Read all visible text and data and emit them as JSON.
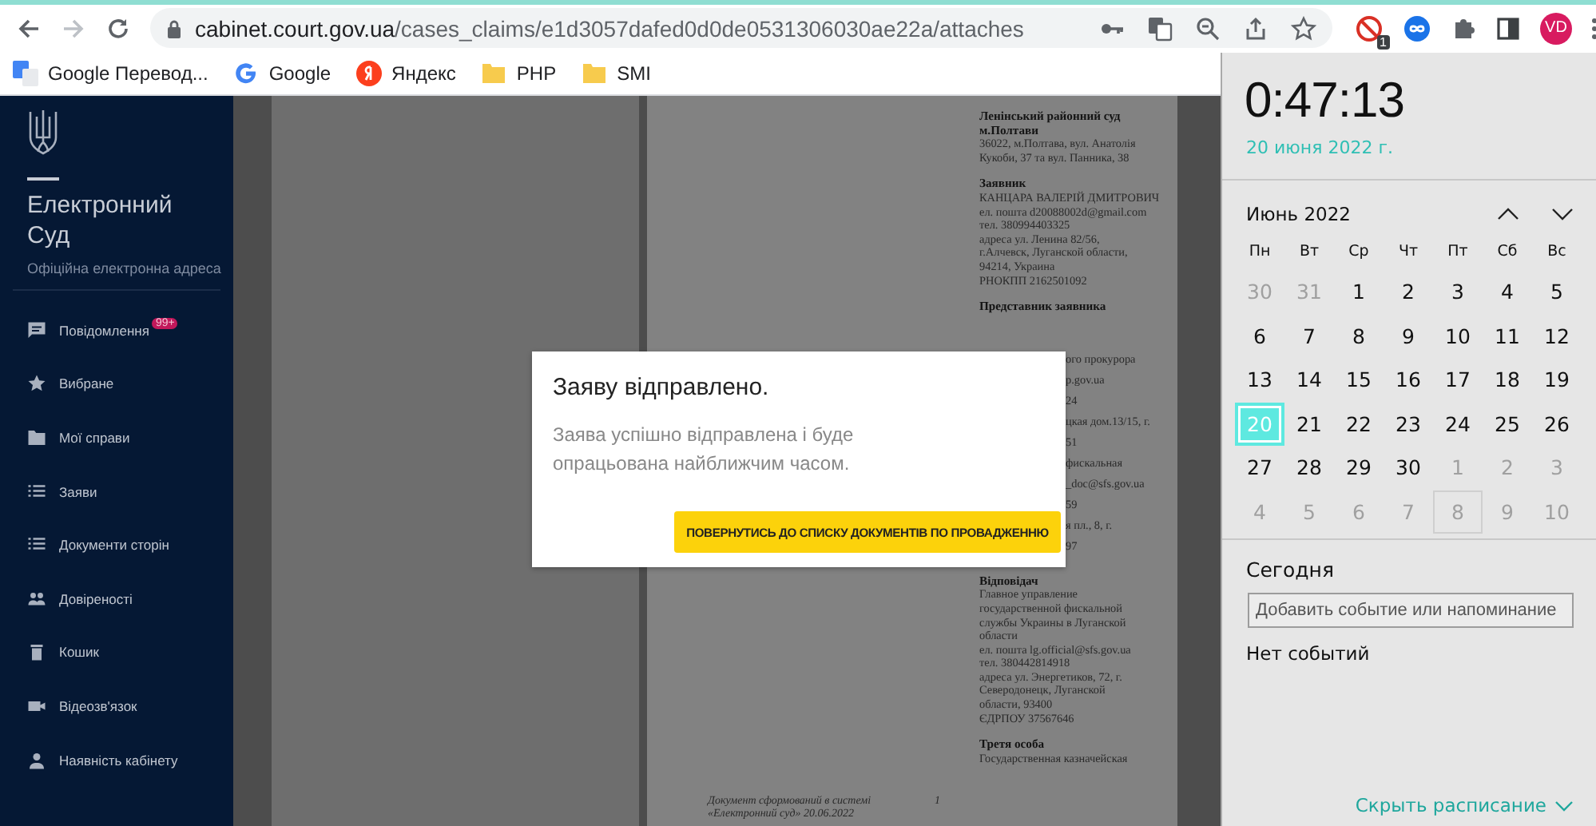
{
  "browser": {
    "url_host": "cabinet.court.gov.ua",
    "url_path": "/cases_claims/e1d3057dafed0d0de0531306030ae22a/attaches",
    "extension_badge": "1",
    "profile": "VD",
    "bookmarks": [
      {
        "label": "Google Перевод...",
        "kind": "translate"
      },
      {
        "label": "Google",
        "kind": "google"
      },
      {
        "label": "Яндекс",
        "kind": "yandex"
      },
      {
        "label": "PHP",
        "kind": "folder"
      },
      {
        "label": "SMI",
        "kind": "folder"
      }
    ]
  },
  "sidebar": {
    "title": "Електронний Суд",
    "subtitle": "Офіційна електронна адреса",
    "items": [
      {
        "label": "Повідомлення",
        "kind": "chat",
        "badge": "99+"
      },
      {
        "label": "Вибране",
        "kind": "star"
      },
      {
        "label": "Мої справи",
        "kind": "folder"
      },
      {
        "label": "Заяви",
        "kind": "list"
      },
      {
        "label": "Документи сторін",
        "kind": "list"
      },
      {
        "label": "Довіреності",
        "kind": "people"
      },
      {
        "label": "Кошик",
        "kind": "trash"
      },
      {
        "label": "Відеозв'язок",
        "kind": "video"
      },
      {
        "label": "Наявність кабінету",
        "kind": "person"
      }
    ]
  },
  "document": {
    "blocks_top": [
      {
        "heading": "Ленінський районний суд\nм.Полтави",
        "text": "36022, м.Полтава, вул. Анатолія\nКукоби, 37 та вул. Панника, 38"
      },
      {
        "heading": "Заявник",
        "text": "КАНЦАРА ВАЛЕРІЙ ДМИТРОВИЧ\nел. пошта d20088002d@gmail.com\nтел. 380994403325\nадреса ул. Ленина 82/56,\nг.Алчевск, Луганской области,\n94214, Украина\nРНОКПП 2162501092"
      },
      {
        "heading": "Представник заявника"
      }
    ],
    "fragments": [
      "ого прокурора",
      "p.gov.ua",
      "24",
      "цкая дом.13/15, г.",
      "51",
      "фискальная",
      "_doc@sfs.gov.ua",
      "59",
      "я пл., 8, г.",
      "97"
    ],
    "blocks_bottom": [
      {
        "heading": "Відповідач",
        "text": "Главное управление\nгосударственной фискальной\nслужбы Украины в Луганской\nобласти\nел. пошта lg.official@sfs.gov.ua\nтел. 380442814918\nадреса ул. Энергетиков, 72, г.\nСеверодонецк, Луганской\nобласти, 93400\nЄДРПОУ 37567646"
      },
      {
        "heading": "Третя особа",
        "text": "Государственная казначейская"
      }
    ],
    "footer": "Документ сформований в системі\n«Електронний суд» 20.06.2022",
    "page_number": "1"
  },
  "modal": {
    "title": "Заяву відправлено.",
    "message": "Заява успішно відправлена і буде опрацьована найближчим часом.",
    "button": "ПОВЕРНУТИСЬ ДО СПИСКУ ДОКУМЕНТІВ ПО ПРОВАДЖЕННЮ"
  },
  "calendar": {
    "time": "0:47:13",
    "date": "20 июня 2022 г.",
    "month": "Июнь 2022",
    "weekdays": [
      "Пн",
      "Вт",
      "Ср",
      "Чт",
      "Пт",
      "Сб",
      "Вс"
    ],
    "days": [
      {
        "label": "30",
        "outside": true,
        "selected": false,
        "focused": false
      },
      {
        "label": "31",
        "outside": true,
        "selected": false,
        "focused": false
      },
      {
        "label": "1",
        "outside": false,
        "selected": false,
        "focused": false
      },
      {
        "label": "2",
        "outside": false,
        "selected": false,
        "focused": false
      },
      {
        "label": "3",
        "outside": false,
        "selected": false,
        "focused": false
      },
      {
        "label": "4",
        "outside": false,
        "selected": false,
        "focused": false
      },
      {
        "label": "5",
        "outside": false,
        "selected": false,
        "focused": false
      },
      {
        "label": "6",
        "outside": false,
        "selected": false,
        "focused": false
      },
      {
        "label": "7",
        "outside": false,
        "selected": false,
        "focused": false
      },
      {
        "label": "8",
        "outside": false,
        "selected": false,
        "focused": false
      },
      {
        "label": "9",
        "outside": false,
        "selected": false,
        "focused": false
      },
      {
        "label": "10",
        "outside": false,
        "selected": false,
        "focused": false
      },
      {
        "label": "11",
        "outside": false,
        "selected": false,
        "focused": false
      },
      {
        "label": "12",
        "outside": false,
        "selected": false,
        "focused": false
      },
      {
        "label": "13",
        "outside": false,
        "selected": false,
        "focused": false
      },
      {
        "label": "14",
        "outside": false,
        "selected": false,
        "focused": false
      },
      {
        "label": "15",
        "outside": false,
        "selected": false,
        "focused": false
      },
      {
        "label": "16",
        "outside": false,
        "selected": false,
        "focused": false
      },
      {
        "label": "17",
        "outside": false,
        "selected": false,
        "focused": false
      },
      {
        "label": "18",
        "outside": false,
        "selected": false,
        "focused": false
      },
      {
        "label": "19",
        "outside": false,
        "selected": false,
        "focused": false
      },
      {
        "label": "20",
        "outside": false,
        "selected": true,
        "focused": false
      },
      {
        "label": "21",
        "outside": false,
        "selected": false,
        "focused": false
      },
      {
        "label": "22",
        "outside": false,
        "selected": false,
        "focused": false
      },
      {
        "label": "23",
        "outside": false,
        "selected": false,
        "focused": false
      },
      {
        "label": "24",
        "outside": false,
        "selected": false,
        "focused": false
      },
      {
        "label": "25",
        "outside": false,
        "selected": false,
        "focused": false
      },
      {
        "label": "26",
        "outside": false,
        "selected": false,
        "focused": false
      },
      {
        "label": "27",
        "outside": false,
        "selected": false,
        "focused": false
      },
      {
        "label": "28",
        "outside": false,
        "selected": false,
        "focused": false
      },
      {
        "label": "29",
        "outside": false,
        "selected": false,
        "focused": false
      },
      {
        "label": "30",
        "outside": false,
        "selected": false,
        "focused": false
      },
      {
        "label": "1",
        "outside": true,
        "selected": false,
        "focused": false
      },
      {
        "label": "2",
        "outside": true,
        "selected": false,
        "focused": false
      },
      {
        "label": "3",
        "outside": true,
        "selected": false,
        "focused": false
      },
      {
        "label": "4",
        "outside": true,
        "selected": false,
        "focused": false
      },
      {
        "label": "5",
        "outside": true,
        "selected": false,
        "focused": false
      },
      {
        "label": "6",
        "outside": true,
        "selected": false,
        "focused": false
      },
      {
        "label": "7",
        "outside": true,
        "selected": false,
        "focused": false
      },
      {
        "label": "8",
        "outside": true,
        "selected": false,
        "focused": true
      },
      {
        "label": "9",
        "outside": true,
        "selected": false,
        "focused": false
      },
      {
        "label": "10",
        "outside": true,
        "selected": false,
        "focused": false
      }
    ],
    "today_label": "Сегодня",
    "event_placeholder": "Добавить событие или напоминание",
    "no_events": "Нет событий",
    "hide_link": "Скрыть расписание"
  }
}
